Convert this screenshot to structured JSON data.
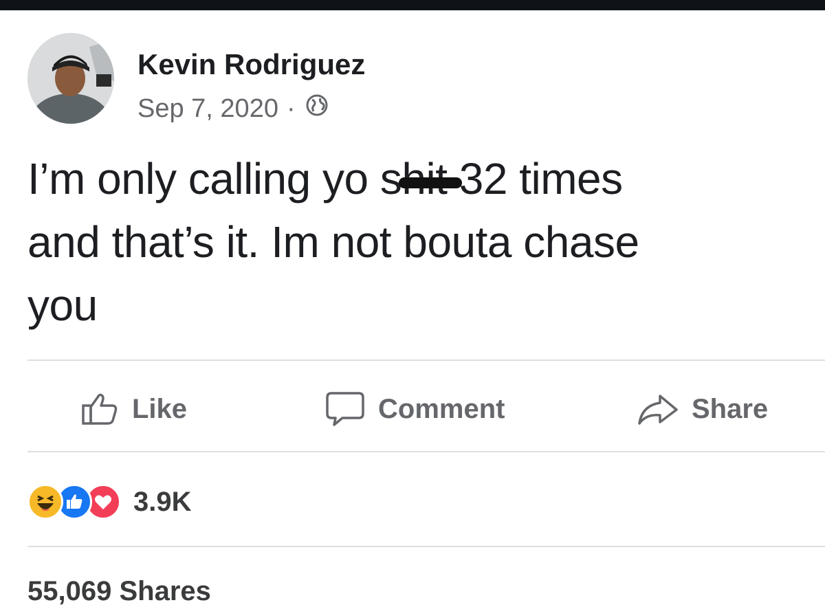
{
  "post": {
    "author": "Kevin Rodriguez",
    "date": "Sep 7, 2020",
    "separator": "·",
    "audience_icon": "globe-icon",
    "text": {
      "line1_before": "I’m only calling yo s",
      "line1_redacted": "hit",
      "line1_after": " 32 times",
      "line2": "and that’s it. Im not bouta chase",
      "line3": "you"
    }
  },
  "actions": {
    "like_label": "Like",
    "comment_label": "Comment",
    "share_label": "Share"
  },
  "reactions": {
    "icons": [
      "haha-icon",
      "like-reaction-icon",
      "love-icon"
    ],
    "count": "3.9K"
  },
  "footer": {
    "shares": "55,069 Shares"
  },
  "colors": {
    "text": "#1c1e21",
    "muted": "#65676b",
    "like_blue": "#1877f2",
    "love_red": "#f33e58",
    "haha_yellow": "#f7b928"
  }
}
